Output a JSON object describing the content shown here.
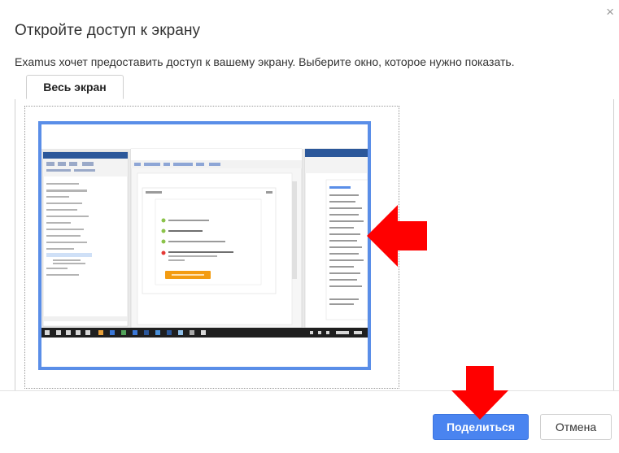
{
  "dialog": {
    "title": "Откройте доступ к экрану",
    "subtitle": "Examus хочет предоставить доступ к вашему экрану. Выберите окно, которое нужно показать.",
    "close_glyph": "×"
  },
  "tabs": [
    {
      "label": "Весь экран",
      "selected": true
    }
  ],
  "buttons": {
    "share_label": "Поделиться",
    "cancel_label": "Отмена"
  },
  "colors": {
    "accent": "#4a84f0",
    "selection_border": "#5a8ee8",
    "annotation_arrow": "#ff0000"
  },
  "icons": [
    "close-icon",
    "right-arrow-annotation",
    "down-arrow-annotation"
  ]
}
